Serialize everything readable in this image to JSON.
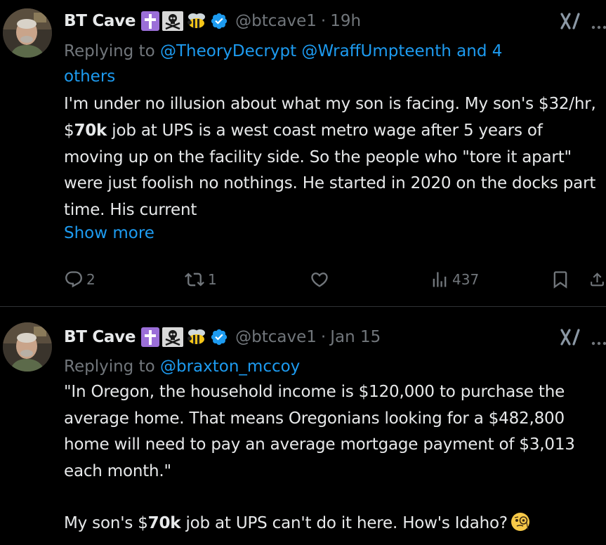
{
  "tweets": [
    {
      "author": {
        "display_name": "BT Cave",
        "handle": "@btcave1",
        "badges": [
          "latin-cross-emoji",
          "skull-crossbones-emoji",
          "bee-emoji",
          "verified-badge-icon"
        ]
      },
      "separator": "·",
      "time": "19h",
      "reply_prefix": "Replying to ",
      "reply_mentions": "@TheoryDecrypt @WraffUmpteenth and 4 others",
      "reply_mention_1": "@TheoryDecrypt",
      "reply_mention_2": "@WraffUmpteenth",
      "reply_and": " and 4",
      "reply_others": "others",
      "body": {
        "p1_a": "I'm under no illusion about what my son is facing. My son's $32/hr, $",
        "p1_bold": "70k",
        "p1_b": " job at UPS is a west coast metro wage after 5 years of moving up on the facility side. So the people who \"tore it apart\" were just foolish no nothings. He started in 2020 on the docks part time. His current"
      },
      "show_more": "Show more",
      "metrics": {
        "replies": "2",
        "reposts": "1",
        "likes": "",
        "views": "437"
      }
    },
    {
      "author": {
        "display_name": "BT Cave",
        "handle": "@btcave1",
        "badges": [
          "latin-cross-emoji",
          "skull-crossbones-emoji",
          "bee-emoji",
          "verified-badge-icon"
        ]
      },
      "separator": "·",
      "time": "Jan 15",
      "reply_prefix": "Replying to ",
      "reply_mention_1": "@braxton_mccoy",
      "body": {
        "p1": "\"In Oregon, the household income is $120,000 to purchase the average home. That means Oregonians looking for a $482,800 home will need to pay an average mortgage payment of $3,013 each month.\"",
        "p2_a": "My son's $",
        "p2_bold": "70k",
        "p2_b": " job at UPS can't do it here. How's Idaho?",
        "emoji": "face-with-monocle-emoji"
      }
    }
  ],
  "colors": {
    "background": "#000000",
    "text": "#e7e9ea",
    "secondary": "#71767b",
    "accent": "#1d9bf0",
    "divider": "#2f3336",
    "verified": "#1d9bf0",
    "cross_badge": "#9b6fd8"
  }
}
